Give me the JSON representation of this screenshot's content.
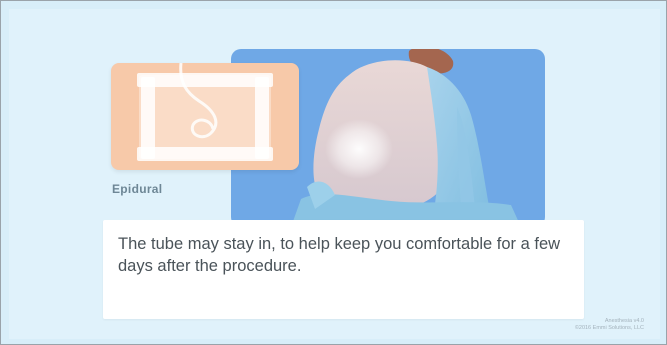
{
  "caption": {
    "text": "The tube may stay in, to help keep you comfortable for a few days after the procedure."
  },
  "inset": {
    "label": "Epidural"
  },
  "footer": {
    "version": "Anesthesia v4.0",
    "copyright": "©2016 Emmi Solutions, LLC"
  },
  "colors": {
    "page_background": "#e0f2fb",
    "illustration_background": "#6fa8e6",
    "inset_background": "#f7c9a9",
    "caption_text": "#4a5359",
    "label_text": "#6e8796"
  }
}
